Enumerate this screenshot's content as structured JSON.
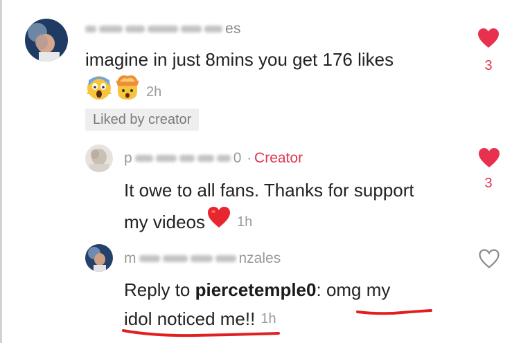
{
  "comments": [
    {
      "name_visible": "es",
      "text": "imagine in just 8mins you get 176 likes",
      "emojis": [
        "scream-emoji",
        "exploding-head-emoji"
      ],
      "time": "2h",
      "badge": "Liked by creator",
      "likes": "3",
      "liked": true
    },
    {
      "name_prefix": "p",
      "name_suffix": "0",
      "separator": "·",
      "tag": "Creator",
      "text_line1": "It owe to all fans. Thanks for support",
      "text_line2": "my videos",
      "emoji": "red-heart-emoji",
      "time": "1h",
      "likes": "3",
      "liked": true
    },
    {
      "name_prefix": "m",
      "name_suffix": "nzales",
      "reply_prefix": "Reply to ",
      "reply_target": "piercetemple0",
      "reply_colon": ":",
      "text_line1_rest": " omg my",
      "text_line2": "idol noticed me!!",
      "time": "1h",
      "liked": false
    }
  ],
  "colors": {
    "accent": "#e0344f",
    "annotation": "#e02020",
    "muted": "#9b9b9b",
    "badge_bg": "#eeeeee"
  }
}
